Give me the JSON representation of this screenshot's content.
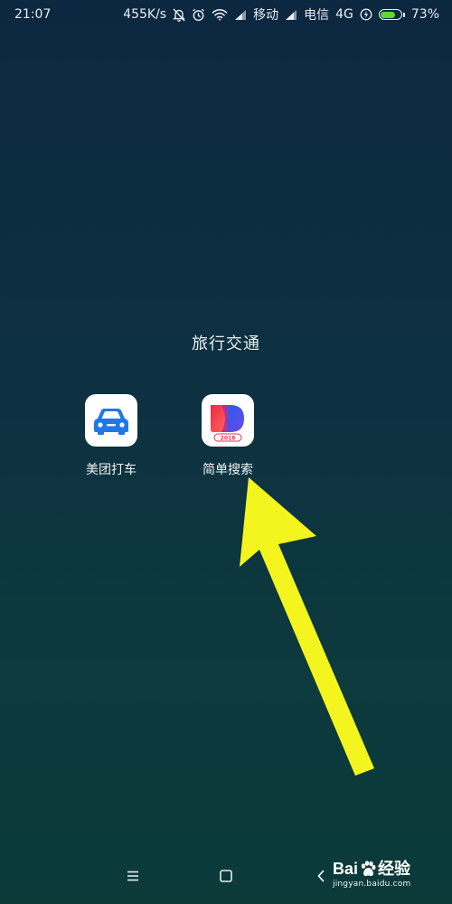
{
  "status_bar": {
    "time": "21:07",
    "net_speed": "455K/s",
    "carrier_1": "移动",
    "carrier_2": "电信",
    "network_type": "4G",
    "battery_percent": "73%",
    "battery_level": 0.73,
    "icons": [
      "mute-bell-icon",
      "alarm-clock-icon",
      "wifi-icon",
      "signal-icon",
      "charging-icon",
      "battery-icon"
    ]
  },
  "folder": {
    "title": "旅行交通",
    "apps": [
      {
        "label": "美团打车",
        "icon": "car-icon",
        "accent": "#1f78e6"
      },
      {
        "label": "简单搜索",
        "icon": "simple-search-logo-icon",
        "badge": "2018",
        "accent": "#e8334f"
      }
    ]
  },
  "annotation": {
    "color": "#f4f51e"
  },
  "navigation": {
    "icons": [
      "menu-icon",
      "home-icon",
      "back-icon"
    ]
  },
  "watermark": {
    "logo_prefix": "Bai",
    "logo_suffix": "经验",
    "url": "jingyan.baidu.com"
  }
}
